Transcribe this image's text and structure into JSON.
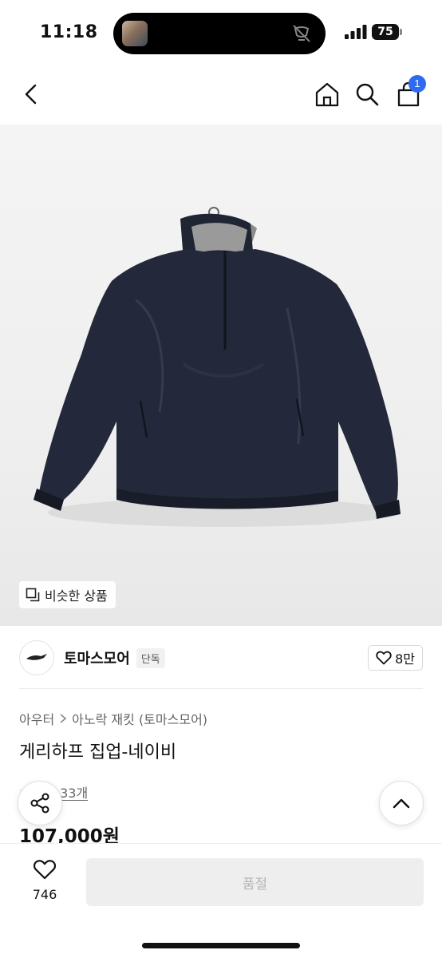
{
  "status_bar": {
    "time": "11:18",
    "battery": "75",
    "icons": [
      "signal-icon",
      "battery-icon",
      "mute-icon"
    ]
  },
  "header": {
    "icons": [
      "back-icon",
      "home-icon",
      "search-icon",
      "cart-icon"
    ],
    "cart_count": "1"
  },
  "product_image": {
    "similar_label": "비슷한 상품",
    "similar_icon": "copy-icon"
  },
  "brand": {
    "name": "토마스모어",
    "badge": "단독",
    "likes": "8만"
  },
  "breadcrumb": {
    "items": [
      "아우터",
      "아노락 재킷 (토마스모어)"
    ]
  },
  "product": {
    "title": "게리하프 집업-네이비",
    "review_text": "후기 33개",
    "price": "107,000원"
  },
  "bottom": {
    "wish_count": "746",
    "buy_label": "품절"
  },
  "colors": {
    "accent_blue": "#2f6bf0",
    "jacket_navy": "#23293a",
    "disabled_bg": "#eeeeee",
    "disabled_text": "#b5b5b5"
  }
}
